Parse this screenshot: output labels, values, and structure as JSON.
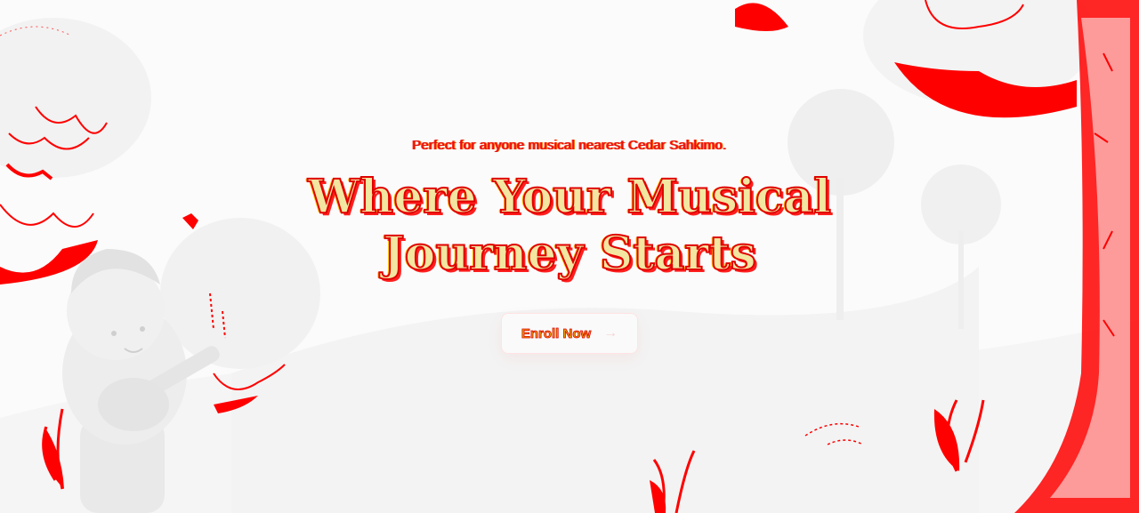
{
  "hero": {
    "tagline": "Perfect for anyone musical nearest Cedar Sahkimo.",
    "headline": "Where Your Musical Journey Starts",
    "cta_label": "Enroll Now",
    "cta_arrow": "→"
  },
  "illustration": {
    "figure": "child-playing-guitar",
    "scene": "park-with-trees-and-leaves"
  },
  "colors": {
    "accent": "#ff0000",
    "headline_fill": "#f2e6a0",
    "cta_text": "#e1a400",
    "background": "#fbfbfb"
  }
}
